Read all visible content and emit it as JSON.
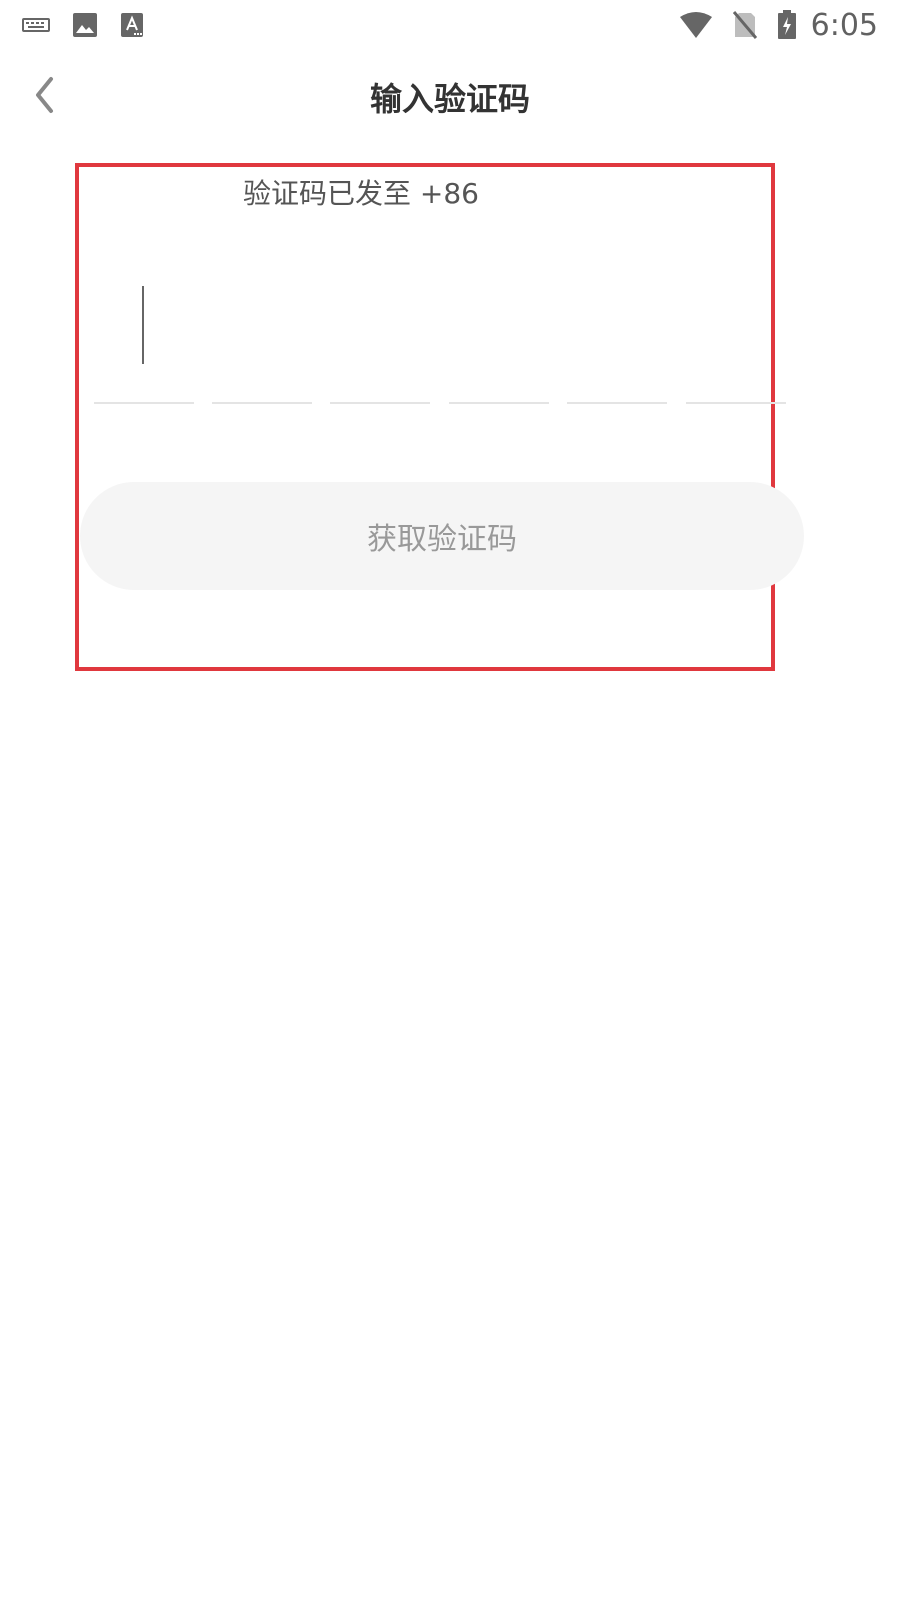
{
  "status_bar": {
    "time": "6:05",
    "left_icons": [
      "keyboard-icon",
      "image-icon",
      "text-a-icon"
    ],
    "right_icons": [
      "wifi-icon",
      "no-sim-icon",
      "battery-charging-icon"
    ]
  },
  "header": {
    "title": "输入验证码",
    "back_icon": "chevron-left-icon"
  },
  "verification": {
    "sent_to_text": "验证码已发至 +86",
    "code_length": 6,
    "code_digits": [
      "",
      "",
      "",
      "",
      "",
      ""
    ]
  },
  "actions": {
    "get_code_label": "获取验证码"
  },
  "colors": {
    "highlight_border": "#e0383e",
    "button_bg": "#f5f5f5",
    "button_text": "#999999",
    "underline": "#e4e4e4"
  }
}
